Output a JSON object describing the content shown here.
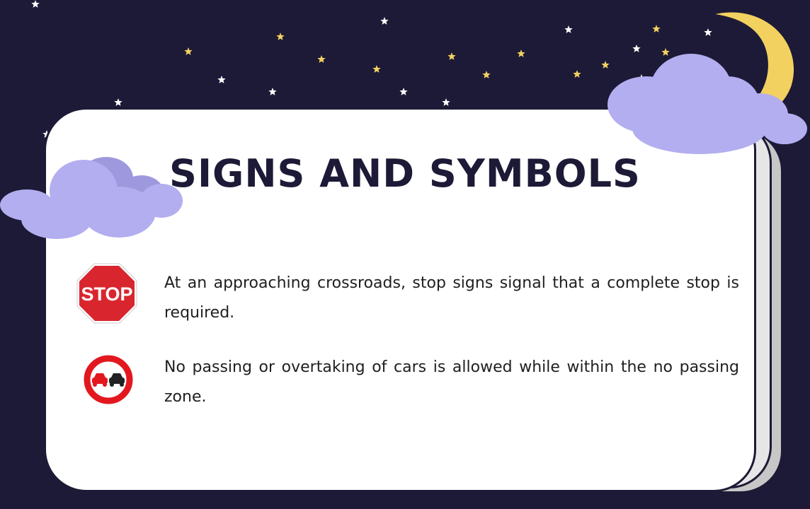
{
  "slide": {
    "title": "SIGNS AND SYMBOLS",
    "items": [
      {
        "icon": "stop-sign-icon",
        "sign_text": "STOP",
        "text": "At an approaching crossroads, stop signs signal that a complete stop is required."
      },
      {
        "icon": "no-passing-sign-icon",
        "text": "No passing or overtaking of cars is allowed while within the no passing zone."
      }
    ]
  },
  "colors": {
    "background": "#1c1a36",
    "card": "#ffffff",
    "cloud": "#b3aef0",
    "moon": "#f2d160",
    "star_yellow": "#f2d160",
    "star_white": "#ffffff",
    "stop_red": "#d9262e",
    "no_passing_red": "#e3181f"
  }
}
